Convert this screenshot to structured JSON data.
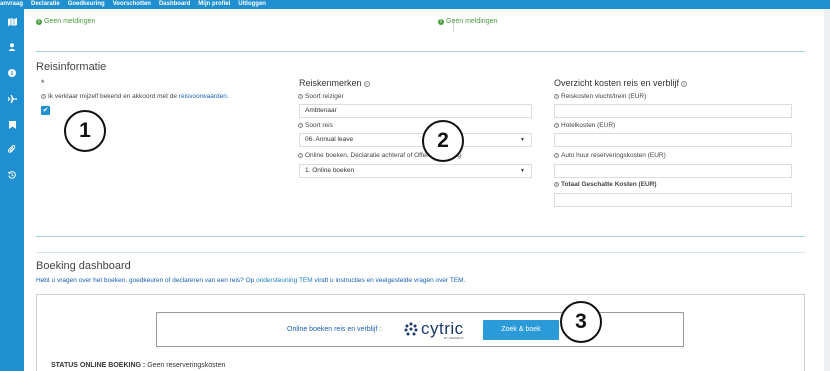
{
  "topnav": {
    "items": [
      "anvraag",
      "Declaratie",
      "Goedkeuring",
      "Voorschotten",
      "Dashboard",
      "Mijn profiel",
      "Uitloggen"
    ]
  },
  "rail": {
    "icons": [
      "map-icon",
      "user-icon",
      "info-icon",
      "plane-icon",
      "bookmark-icon",
      "paperclip-icon",
      "history-icon"
    ]
  },
  "messages": {
    "left": "Geen meldingen",
    "right": "Geen meldingen"
  },
  "reisinformatie": {
    "title": "Reisinformatie",
    "asterisk": "*",
    "agree_text": "Ik verklaar mijzelf bekend en akkoord met de",
    "agree_link": "reisvoorwaarden",
    "agree_end": ".",
    "checkbox_mark": "✔"
  },
  "reiskenmerken": {
    "title": "Reiskenmerken",
    "soort_reiziger_label": "Soort reiziger",
    "soort_reiziger_value": "Ambtenaar",
    "soort_reis_label": "Soort reis",
    "soort_reis_value": "06. Annual leave",
    "online_label": "Online boeken, Declaratie achteraf of Offerteaanvraag",
    "online_value": "1. Online boeken"
  },
  "overzicht": {
    "title": "Overzicht kosten reis en verblijf",
    "vlucht_label": "Reiskosten vlucht/trein (EUR)",
    "hotel_label": "Hotelkosten (EUR)",
    "auto_label": "Auto huur reserveringskosten (EUR)",
    "totaal_label": "Totaal Geschatte Kosten (EUR)"
  },
  "badges": {
    "one": "1",
    "two": "2",
    "three": "3"
  },
  "dashboard": {
    "title": "Boeking dashboard",
    "info_start": "Hebt u vragen over het boeken, goedkeuren of declareren van een reis? Op",
    "info_link": "ondersteuning TEM",
    "info_end": "vindt u instructies en veelgestelde vragen over TEM.",
    "online_label": "Online boeken reis en verblijf :",
    "cytric_word": "cytric",
    "cytric_sub": "BY AMADEUS",
    "zoek_button": "Zoek & boek",
    "status_label": "STATUS ONLINE BOEKING :",
    "status_value": "Geen reserveringskosten"
  },
  "colors": {
    "brand": "#1f8fd0",
    "success": "#4a9c3d",
    "link": "#1a5fb4",
    "button": "#2a9bd8"
  }
}
